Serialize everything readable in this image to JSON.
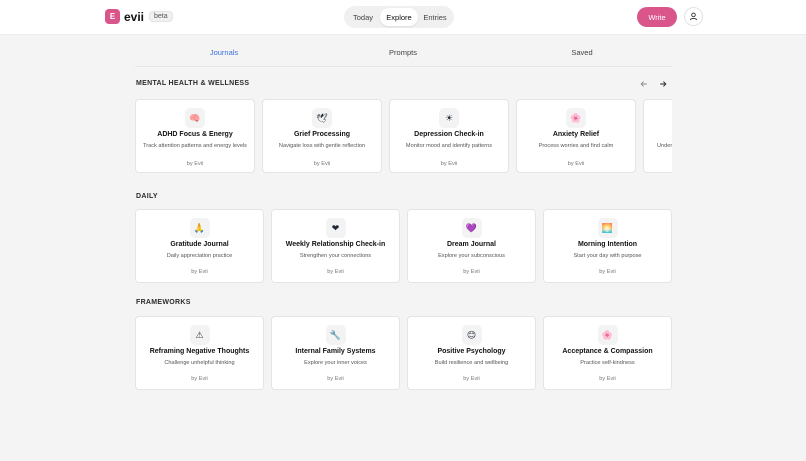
{
  "app": {
    "logo_letter": "E",
    "name": "evii",
    "badge": "beta"
  },
  "nav": {
    "items": [
      "Today",
      "Explore",
      "Entries"
    ],
    "active": "Explore"
  },
  "header": {
    "write_label": "Write",
    "user_icon": "user-icon"
  },
  "tabs": {
    "items": [
      "Journals",
      "Prompts",
      "Saved"
    ],
    "active": "Journals"
  },
  "accent_color": "#3b6fd8",
  "brand_color": "#d9558a",
  "sections": [
    {
      "title": "MENTAL HEALTH & WELLNESS",
      "cards": [
        {
          "icon": "brain-icon",
          "emoji": "🧠",
          "title": "ADHD Focus & Energy",
          "description": "Track attention patterns and energy levels",
          "author": "by Evii"
        },
        {
          "icon": "dove-icon",
          "emoji": "🕊",
          "title": "Grief Processing",
          "description": "Navigate loss with gentle reflection",
          "author": "by Evii"
        },
        {
          "icon": "sun-icon",
          "emoji": "☀",
          "title": "Depression Check-in",
          "description": "Monitor mood and identify patterns",
          "author": "by Evii"
        },
        {
          "icon": "flower-icon",
          "emoji": "🌸",
          "title": "Anxiety Relief",
          "description": "Process worries and find calm",
          "author": "by Evii"
        },
        {
          "icon": "partial-icon",
          "emoji": "",
          "title": "",
          "description": "Under",
          "author": ""
        }
      ]
    },
    {
      "title": "DAILY",
      "cards": [
        {
          "icon": "pray-icon",
          "emoji": "🙏",
          "title": "Gratitude Journal",
          "description": "Daily appreciation practice",
          "author": "by Evii"
        },
        {
          "icon": "heart-icon",
          "emoji": "❤",
          "title": "Weekly Relationship Check-in",
          "description": "Strengthen your connections",
          "author": "by Evii"
        },
        {
          "icon": "purple-heart-icon",
          "emoji": "💜",
          "title": "Dream Journal",
          "description": "Explore your subconscious",
          "author": "by Evii"
        },
        {
          "icon": "sunrise-icon",
          "emoji": "🌅",
          "title": "Morning Intention",
          "description": "Start your day with purpose",
          "author": "by Evii"
        }
      ]
    },
    {
      "title": "FRAMEWORKS",
      "cards": [
        {
          "icon": "warning-icon",
          "emoji": "⚠",
          "title": "Reframing Negative Thoughts",
          "description": "Challenge unhelpful thinking",
          "author": "by Evii"
        },
        {
          "icon": "wrench-icon",
          "emoji": "🔧",
          "title": "Internal Family Systems",
          "description": "Explore your inner voices",
          "author": "by Evii"
        },
        {
          "icon": "smile-icon",
          "emoji": "😊",
          "title": "Positive Psychology",
          "description": "Build resilience and wellbeing",
          "author": "by Evii"
        },
        {
          "icon": "blossom-icon",
          "emoji": "🌸",
          "title": "Acceptance & Compassion",
          "description": "Practice self-kindness",
          "author": "by Evii"
        }
      ]
    }
  ]
}
